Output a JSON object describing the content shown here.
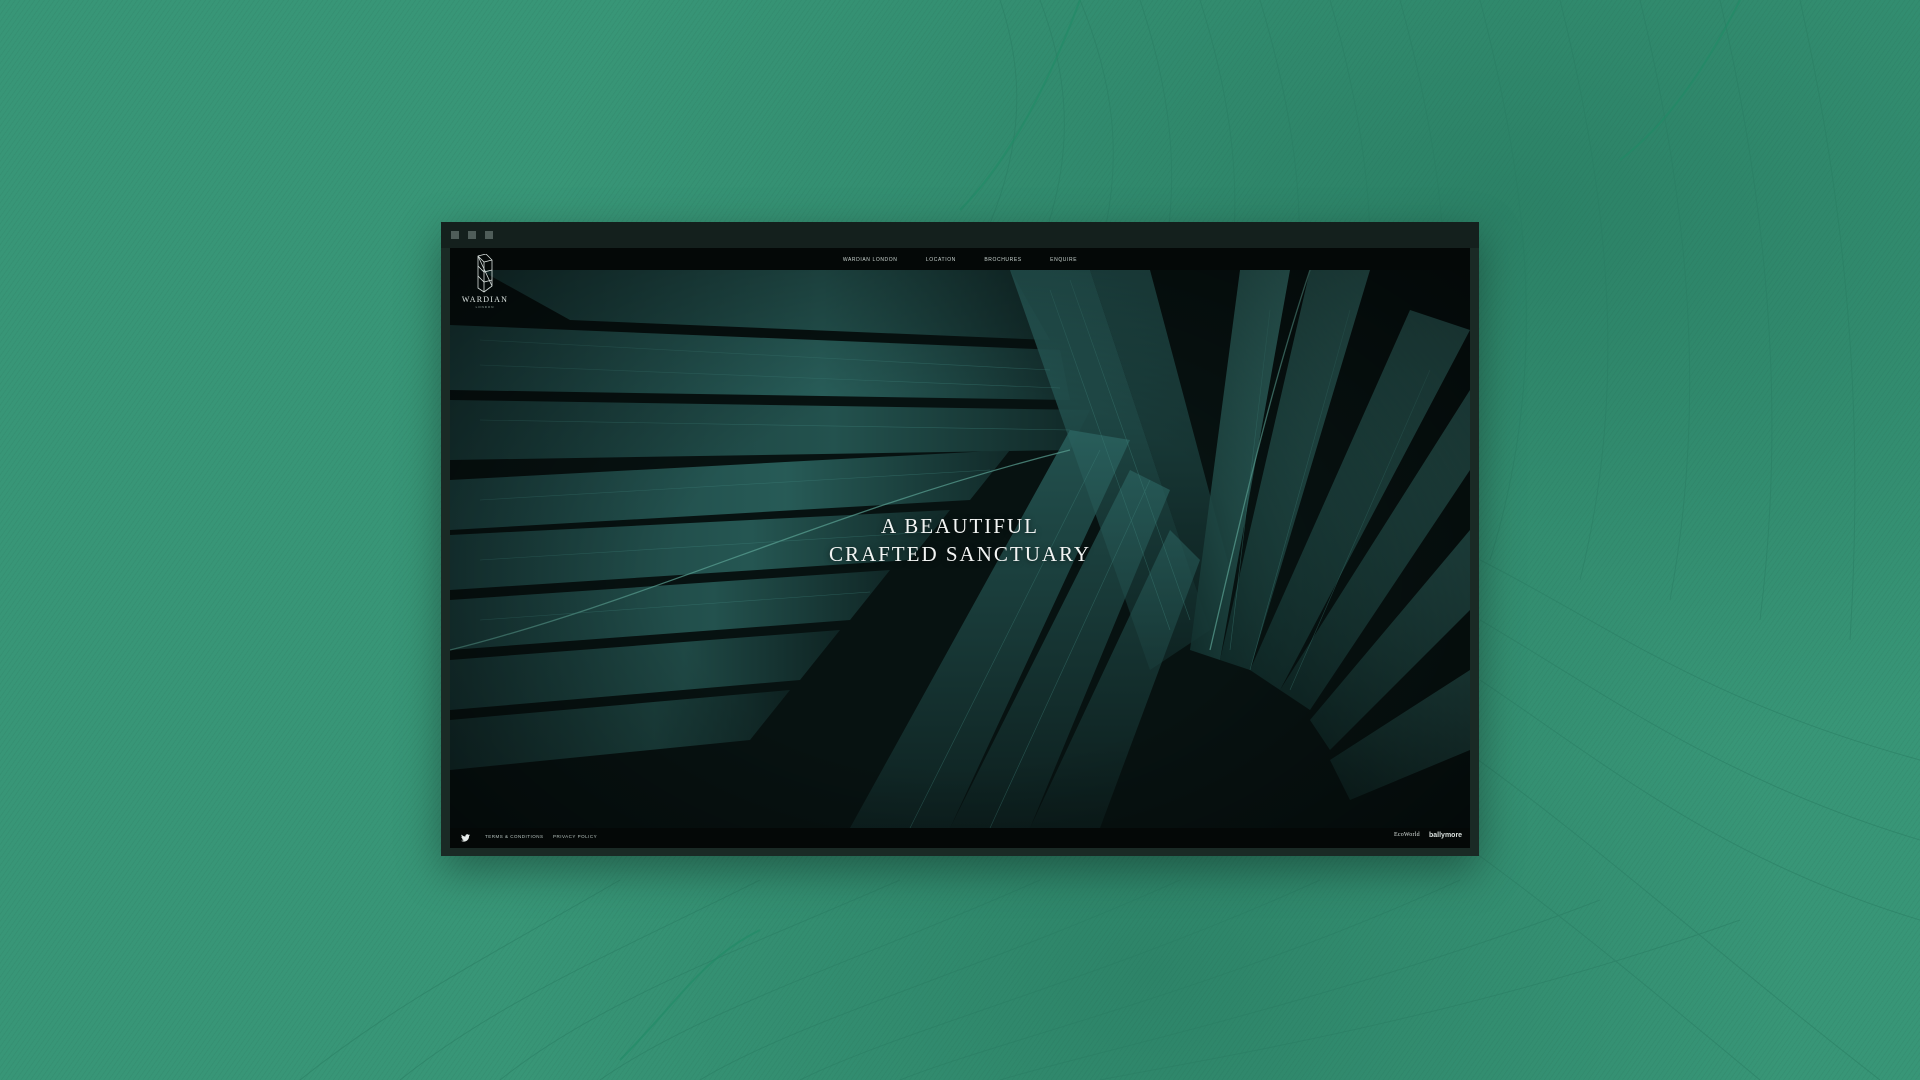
{
  "nav": {
    "items": [
      {
        "label": "Wardian London"
      },
      {
        "label": "Location"
      },
      {
        "label": "Brochures"
      },
      {
        "label": "Enquire"
      }
    ]
  },
  "logo": {
    "name": "WARDIAN",
    "sub": "LONDON"
  },
  "hero": {
    "line1": "A BEAUTIFUL",
    "line2": "CRAFTED SANCTUARY"
  },
  "footer": {
    "terms": "Terms & Conditions",
    "privacy": "Privacy Policy",
    "partners": [
      "EcoWorld",
      "ballymore"
    ]
  },
  "icons": {
    "social": "twitter-icon"
  },
  "colors": {
    "background": "#389677",
    "window": "#1a2a25",
    "leaf": "#2f6d68"
  }
}
